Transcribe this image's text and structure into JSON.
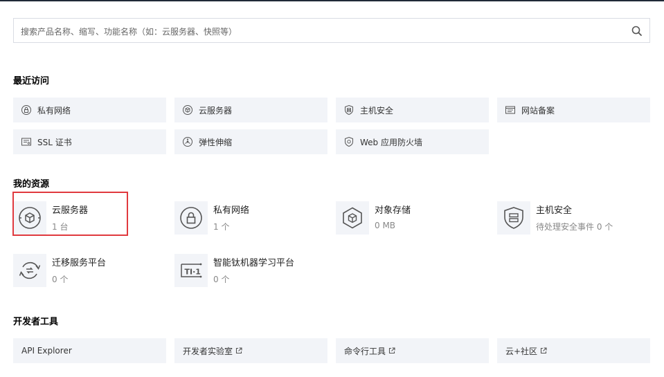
{
  "search": {
    "placeholder": "搜索产品名称、缩写、功能名称（如：云服务器、快照等）",
    "icon": "search-icon"
  },
  "recent": {
    "title": "最近访问",
    "items": [
      {
        "label": "私有网络",
        "icon": "vpc-lock-icon"
      },
      {
        "label": "云服务器",
        "icon": "cube-icon"
      },
      {
        "label": "主机安全",
        "icon": "shield-icon"
      },
      {
        "label": "网站备案",
        "icon": "record-icon"
      },
      {
        "label": "SSL 证书",
        "icon": "certificate-icon"
      },
      {
        "label": "弹性伸缩",
        "icon": "scaling-icon"
      },
      {
        "label": "Web 应用防火墙",
        "icon": "firewall-shield-icon"
      }
    ]
  },
  "resources": {
    "title": "我的资源",
    "items": [
      {
        "name": "云服务器",
        "value": "1 台",
        "icon": "cube-icon"
      },
      {
        "name": "私有网络",
        "value": "1 个",
        "icon": "vpc-lock-icon"
      },
      {
        "name": "对象存储",
        "value": "0 MB",
        "icon": "storage-hex-icon"
      },
      {
        "name": "主机安全",
        "value": "待处理安全事件 0 个",
        "icon": "shield-icon"
      },
      {
        "name": "迁移服务平台",
        "value": "0 个",
        "icon": "migrate-icon"
      },
      {
        "name": "智能钛机器学习平台",
        "value": "0 个",
        "icon": "ti-ml-icon"
      }
    ]
  },
  "devtools": {
    "title": "开发者工具",
    "items": [
      {
        "label": "API Explorer",
        "external": false
      },
      {
        "label": "开发者实验室",
        "external": true
      },
      {
        "label": "命令行工具",
        "external": true
      },
      {
        "label": "云+社区",
        "external": true
      }
    ]
  },
  "colors": {
    "chip_bg": "#f2f4f8",
    "highlight": "#e0393e",
    "icon": "#555555"
  }
}
